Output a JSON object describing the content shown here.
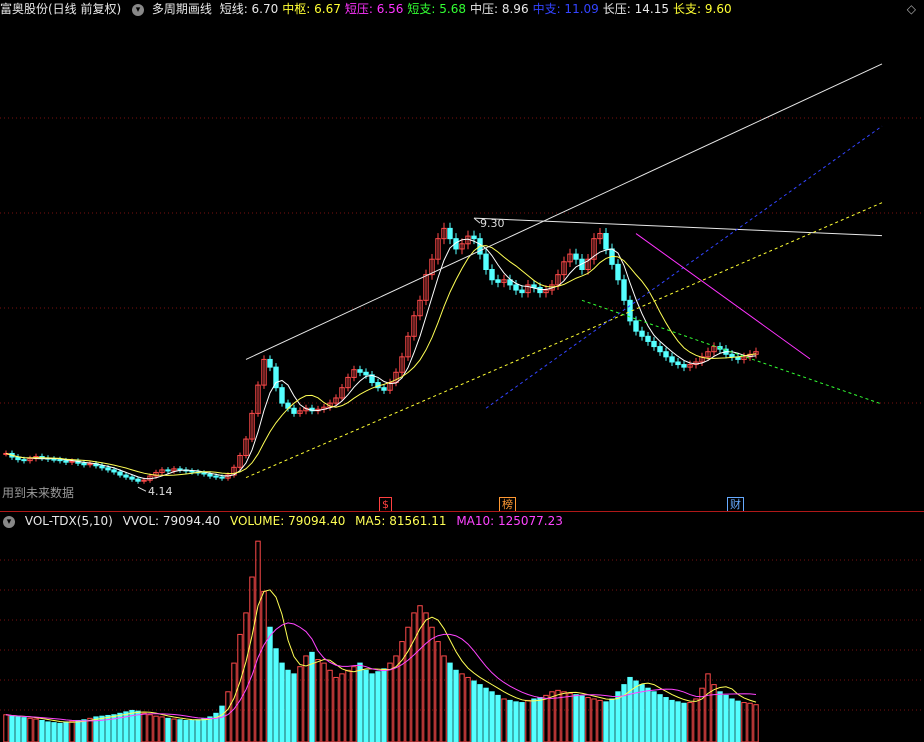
{
  "header": {
    "title": "富奥股份(日线 前复权)",
    "indicator_name": "多周期画线",
    "items": [
      {
        "label": "短线: 6.70",
        "color": "#e8e8e8"
      },
      {
        "label": "中枢: 6.67",
        "color": "#ffff33"
      },
      {
        "label": "短压: 6.56",
        "color": "#ff33ff"
      },
      {
        "label": "短支: 5.68",
        "color": "#33ff33"
      },
      {
        "label": "中压: 8.96",
        "color": "#e8e8e8"
      },
      {
        "label": "中支: 11.09",
        "color": "#3344ff"
      },
      {
        "label": "长压: 14.15",
        "color": "#e8e8e8"
      },
      {
        "label": "长支: 9.60",
        "color": "#ffff33"
      }
    ]
  },
  "annotations": {
    "high_label": "9.30",
    "low_label": "4.14",
    "future_data": "用到未来数据",
    "markers": [
      {
        "text": "$",
        "color": "#ff4040"
      },
      {
        "text": "榜",
        "color": "#ff9933"
      },
      {
        "text": "财",
        "color": "#66aaff"
      }
    ]
  },
  "volume_header": {
    "name": "VOL-TDX(5,10)",
    "vvol": "VVOL: 79094.40",
    "volume": "VOLUME: 79094.40",
    "ma5": "MA5: 81561.11",
    "ma10": "MA10: 125077.23"
  },
  "colors": {
    "up": "#ff4a4a",
    "down": "#55ffff",
    "background": "#000000",
    "grid": "#7a1010",
    "ma_short": "#ffffff",
    "ma_mid": "#ffff55",
    "ma10": "#ff44ff"
  },
  "chart_data": {
    "type": "candlestick",
    "prices": [
      4.72,
      4.65,
      4.6,
      4.58,
      4.62,
      4.66,
      4.63,
      4.61,
      4.6,
      4.58,
      4.55,
      4.57,
      4.53,
      4.5,
      4.52,
      4.48,
      4.44,
      4.4,
      4.36,
      4.3,
      4.26,
      4.22,
      4.18,
      4.2,
      4.28,
      4.35,
      4.4,
      4.38,
      4.42,
      4.4,
      4.38,
      4.36,
      4.34,
      4.32,
      4.28,
      4.26,
      4.24,
      4.3,
      4.45,
      4.68,
      5.0,
      5.5,
      6.05,
      6.55,
      6.4,
      6.0,
      5.7,
      5.6,
      5.5,
      5.55,
      5.6,
      5.55,
      5.58,
      5.62,
      5.7,
      5.8,
      6.0,
      6.2,
      6.35,
      6.3,
      6.25,
      6.1,
      6.0,
      5.95,
      6.1,
      6.3,
      6.6,
      7.0,
      7.4,
      7.7,
      8.2,
      8.5,
      8.9,
      9.1,
      8.9,
      8.7,
      8.8,
      8.95,
      8.9,
      8.6,
      8.3,
      8.1,
      8.05,
      8.1,
      8.0,
      7.9,
      7.85,
      8.0,
      7.95,
      7.85,
      7.9,
      8.0,
      8.2,
      8.45,
      8.6,
      8.5,
      8.3,
      8.5,
      8.9,
      9.0,
      8.7,
      8.4,
      8.1,
      7.7,
      7.3,
      7.1,
      7.0,
      6.9,
      6.8,
      6.7,
      6.6,
      6.5,
      6.45,
      6.4,
      6.45,
      6.5,
      6.6,
      6.7,
      6.8,
      6.75,
      6.65,
      6.6,
      6.55,
      6.6,
      6.65,
      6.7
    ],
    "volume": [
      38000,
      36000,
      35000,
      34000,
      33000,
      32000,
      30000,
      28000,
      27000,
      26000,
      28000,
      29000,
      30000,
      31000,
      33000,
      35000,
      36000,
      37000,
      38000,
      40000,
      42000,
      44000,
      43000,
      40000,
      38000,
      36000,
      35000,
      33000,
      32000,
      31000,
      30000,
      30000,
      31000,
      33000,
      35000,
      40000,
      50000,
      70000,
      110000,
      150000,
      180000,
      230000,
      280000,
      210000,
      160000,
      130000,
      110000,
      100000,
      95000,
      105000,
      120000,
      125000,
      115000,
      110000,
      100000,
      90000,
      95000,
      100000,
      105000,
      110000,
      100000,
      95000,
      98000,
      102000,
      110000,
      120000,
      140000,
      160000,
      180000,
      190000,
      180000,
      160000,
      140000,
      120000,
      110000,
      100000,
      95000,
      90000,
      85000,
      80000,
      75000,
      70000,
      65000,
      60000,
      58000,
      56000,
      55000,
      58000,
      60000,
      62000,
      65000,
      70000,
      72000,
      70000,
      68000,
      66000,
      64000,
      62000,
      60000,
      58000,
      56000,
      60000,
      70000,
      80000,
      90000,
      85000,
      80000,
      75000,
      70000,
      66000,
      62000,
      58000,
      56000,
      54000,
      55000,
      60000,
      75000,
      95000,
      80000,
      70000,
      65000,
      60000,
      57000,
      55000,
      54000,
      52000
    ],
    "ylim_price": [
      3.6,
      13.0
    ],
    "ylim_volume": [
      0,
      290000
    ],
    "lines": [
      {
        "name": "长压",
        "from": [
          40,
          6.55
        ],
        "to": [
          146,
          12.3
        ],
        "color": "#e8e8e8"
      },
      {
        "name": "中压",
        "from": [
          78,
          9.3
        ],
        "to": [
          146,
          8.96
        ],
        "color": "#e8e8e8"
      },
      {
        "name": "长支",
        "from": [
          40,
          4.25
        ],
        "to": [
          146,
          9.6
        ],
        "color": "#ffff33",
        "dashed": true
      },
      {
        "name": "中支",
        "from": [
          80,
          5.6
        ],
        "to": [
          146,
          11.09
        ],
        "color": "#3344ff",
        "dashed": true
      },
      {
        "name": "短压",
        "from": [
          105,
          9.0
        ],
        "to": [
          134,
          6.56
        ],
        "color": "#ff33ff"
      },
      {
        "name": "短支",
        "from": [
          96,
          7.7
        ],
        "to": [
          146,
          5.68
        ],
        "color": "#33ff33",
        "dashed": true
      }
    ]
  }
}
